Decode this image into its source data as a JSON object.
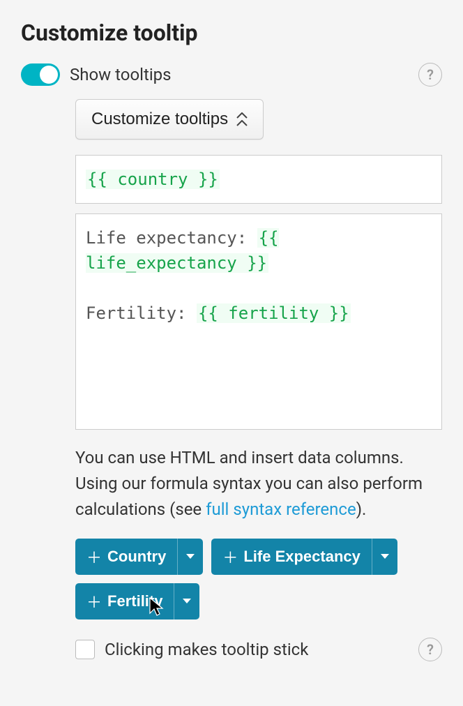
{
  "title": "Customize tooltip",
  "toggle": {
    "label": "Show tooltips",
    "on": true
  },
  "collapse_button": "Customize tooltips",
  "template_header": {
    "prefix": "",
    "token": "{{ country }}",
    "suffix": ""
  },
  "template_body": {
    "line1_prefix": "Life expectancy: ",
    "line1_token": "{{ life_expectancy }}",
    "line2_prefix": "Fertility: ",
    "line2_token": "{{ fertility }}"
  },
  "description": {
    "text1": "You can use HTML and insert data columns. Using our formula syntax you can also perform calculations (see ",
    "link": "full syntax reference",
    "text2": ")."
  },
  "columns": [
    {
      "label": "Country"
    },
    {
      "label": "Life Expectancy"
    },
    {
      "label": "Fertility"
    }
  ],
  "sticky": {
    "label": "Clicking makes tooltip stick",
    "checked": false
  },
  "help_glyph": "?"
}
